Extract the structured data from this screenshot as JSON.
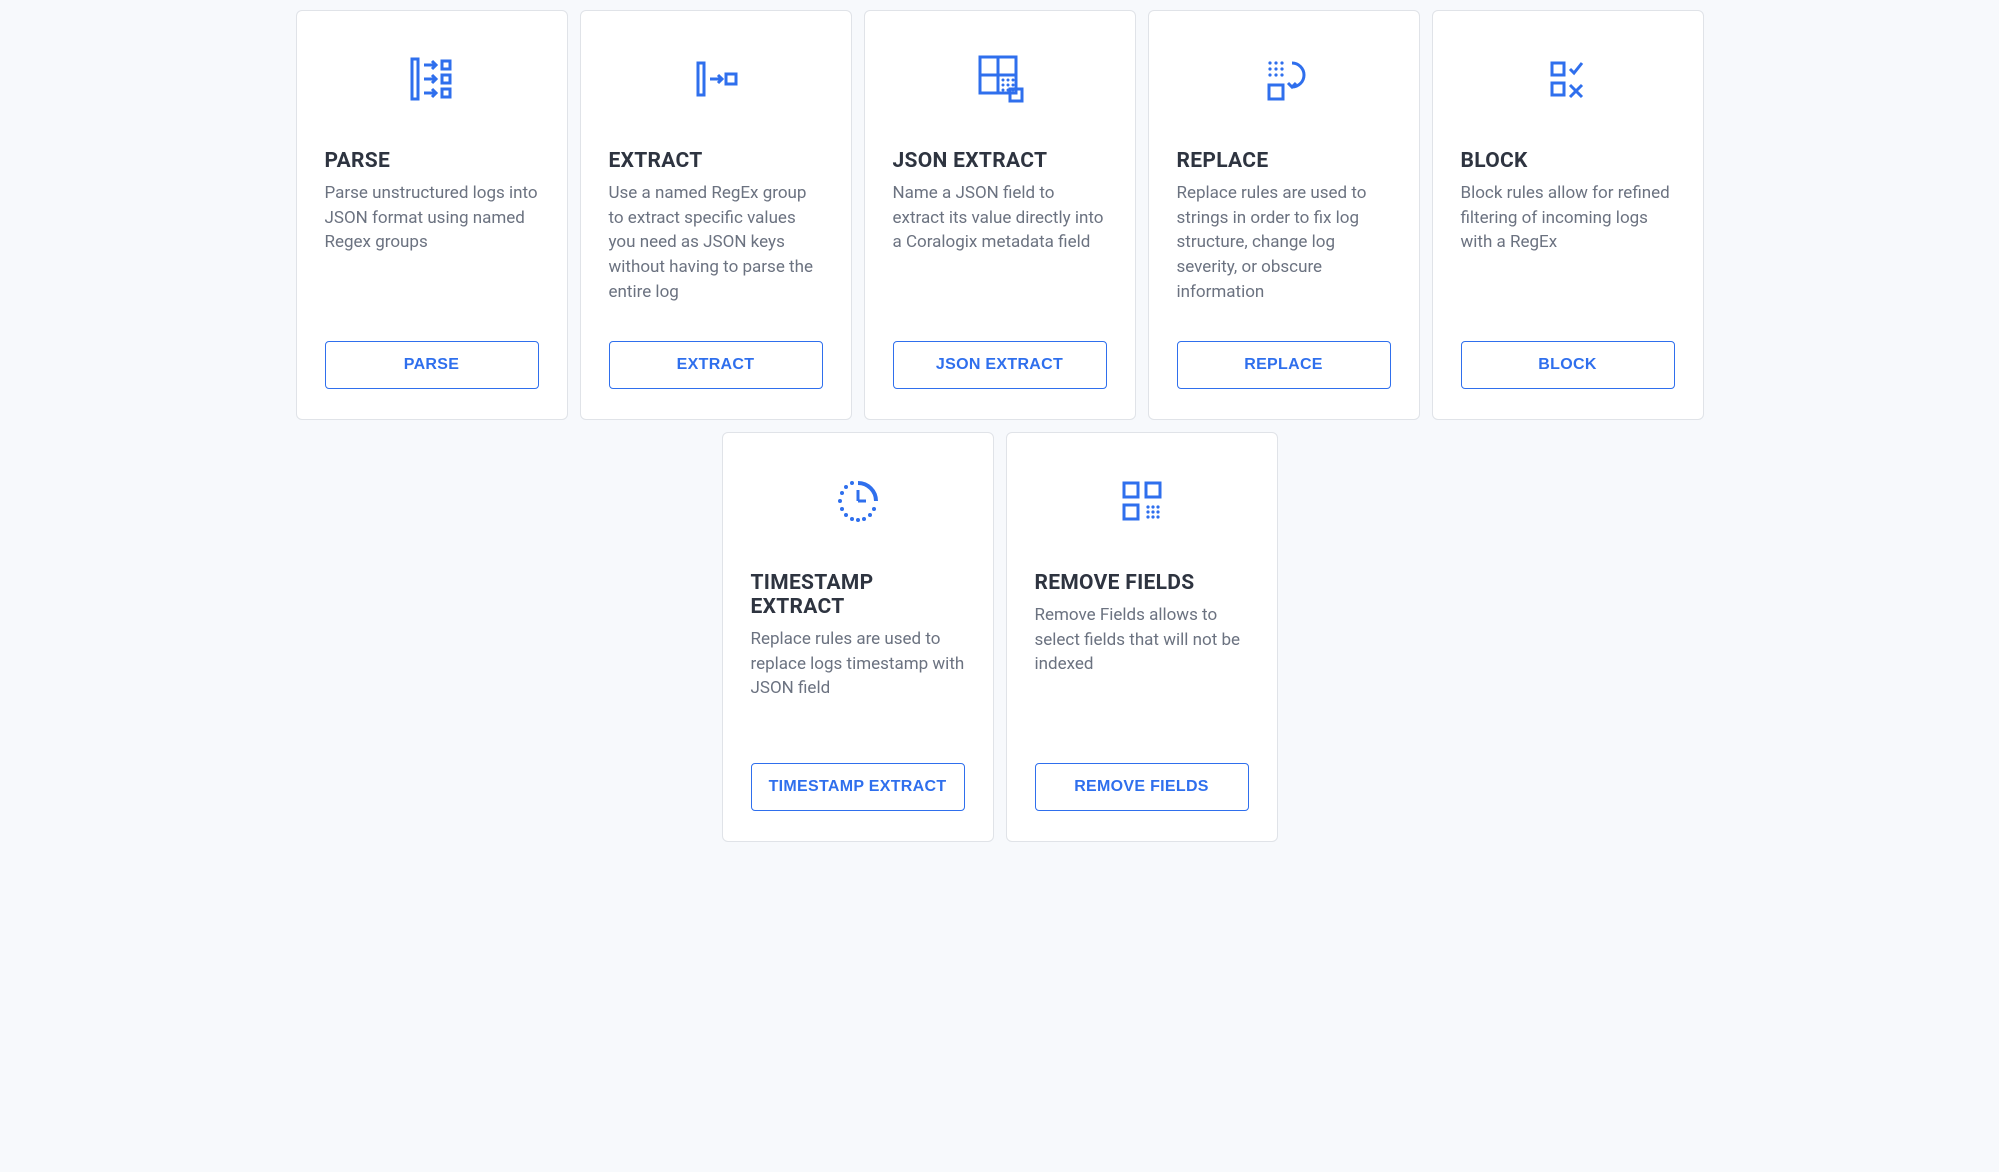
{
  "cards": [
    {
      "title": "PARSE",
      "description": "Parse unstructured logs into JSON format using named Regex groups",
      "button": "PARSE",
      "icon": "parse-icon"
    },
    {
      "title": "EXTRACT",
      "description": "Use a named RegEx group to extract specific values you need as JSON keys without having to parse the entire log",
      "button": "EXTRACT",
      "icon": "extract-icon"
    },
    {
      "title": "JSON EXTRACT",
      "description": "Name a JSON field to extract its value directly into a Coralogix metadata field",
      "button": "JSON EXTRACT",
      "icon": "json-extract-icon"
    },
    {
      "title": "REPLACE",
      "description": "Replace rules are used to strings in order to fix log structure, change log severity, or obscure information",
      "button": "REPLACE",
      "icon": "replace-icon"
    },
    {
      "title": "BLOCK",
      "description": "Block rules allow for refined filtering of incoming logs with a RegEx",
      "button": "BLOCK",
      "icon": "block-icon"
    },
    {
      "title": "TIMESTAMP EXTRACT",
      "description": "Replace rules are used to replace logs timestamp with JSON field",
      "button": "TIMESTAMP EXTRACT",
      "icon": "timestamp-extract-icon"
    },
    {
      "title": "REMOVE FIELDS",
      "description": "Remove Fields allows to select fields that will not be indexed",
      "button": "REMOVE FIELDS",
      "icon": "remove-fields-icon"
    }
  ],
  "colors": {
    "accent": "#2f6fed",
    "title": "#2e3440",
    "body": "#6b7280"
  }
}
